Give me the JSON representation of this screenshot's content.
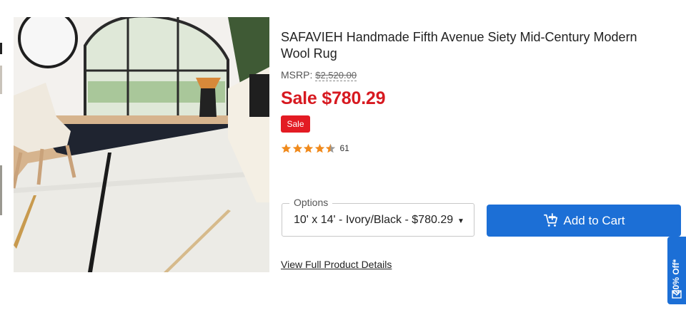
{
  "product": {
    "title": "SAFAVIEH Handmade Fifth Avenue Siety Mid-Century Modern Wool Rug",
    "msrp_label": "MSRP: ",
    "msrp_value": "$2,520.00",
    "sale_price": "Sale $780.29",
    "sale_badge": "Sale",
    "rating_stars": 4.5,
    "review_count": "61"
  },
  "options": {
    "label": "Options",
    "selected": "10' x 14' - Ivory/Black - $780.29",
    "arrow": "▼"
  },
  "actions": {
    "add_to_cart": "Add to Cart",
    "view_details": "View Full Product Details"
  },
  "promo": {
    "label": "20% Off*"
  },
  "colors": {
    "sale_red": "#d71920",
    "primary_blue": "#1c6fd6",
    "star_orange": "#f08a1c"
  }
}
